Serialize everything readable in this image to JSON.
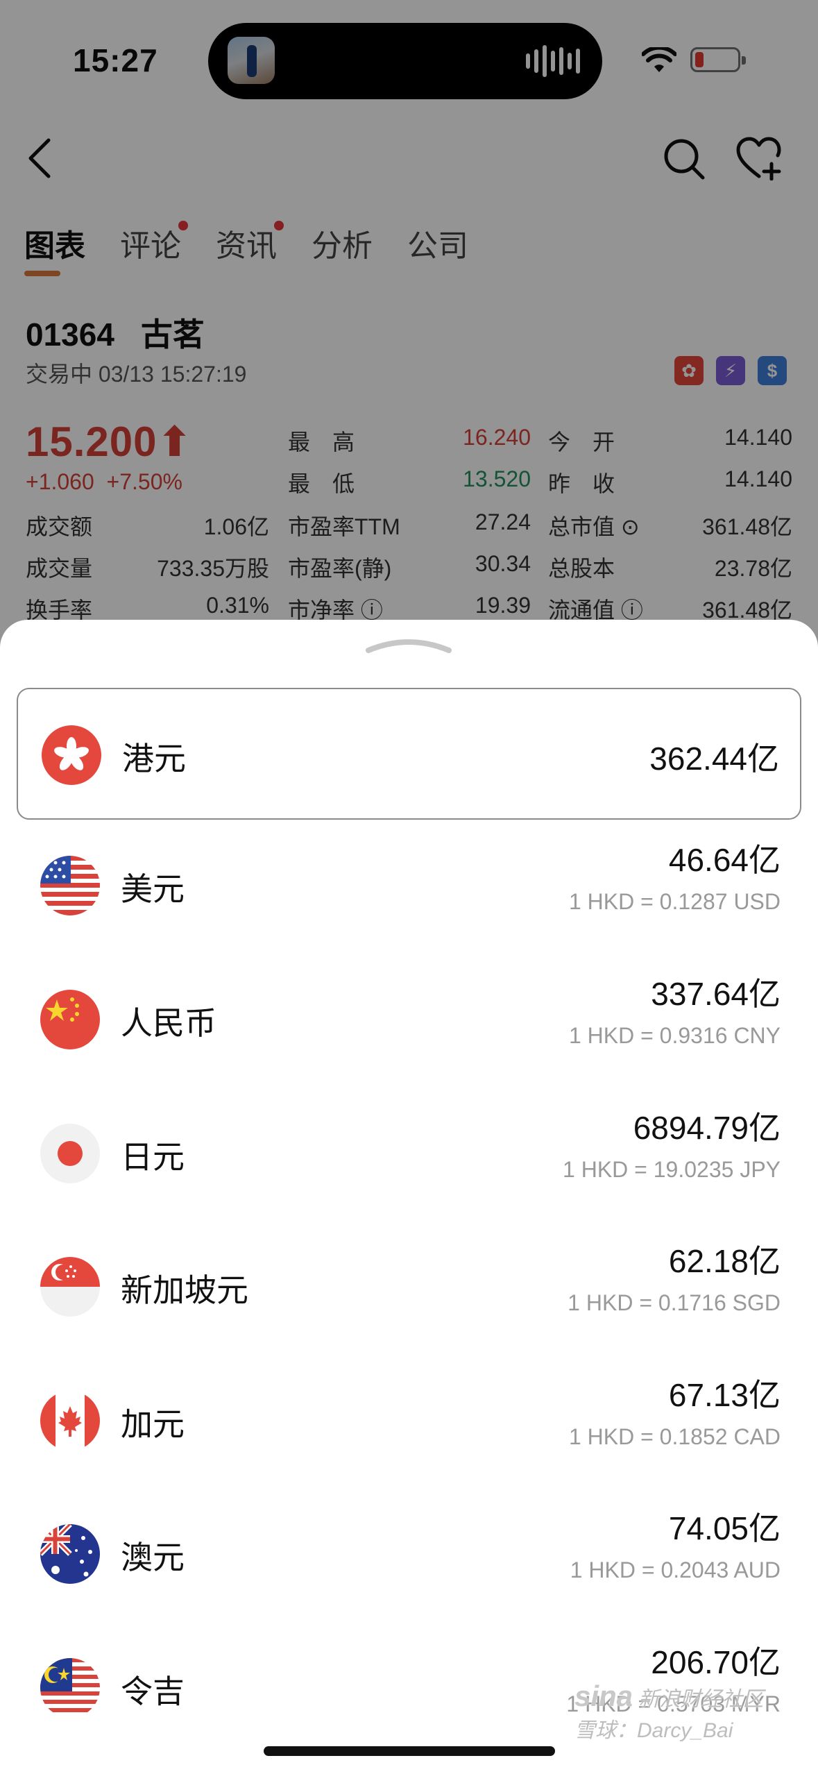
{
  "status_bar": {
    "time": "15:27"
  },
  "tabs": [
    {
      "label": "图表",
      "active": true,
      "dot": false
    },
    {
      "label": "评论",
      "active": false,
      "dot": true
    },
    {
      "label": "资讯",
      "active": false,
      "dot": true
    },
    {
      "label": "分析",
      "active": false,
      "dot": false
    },
    {
      "label": "公司",
      "active": false,
      "dot": false
    }
  ],
  "stock": {
    "code": "01364",
    "name": "古茗",
    "status": "交易中 03/13 15:27:19",
    "price": "15.200",
    "change": "+1.060",
    "change_pct": "+7.50%",
    "high_label": "最　高",
    "high_value": "16.240",
    "low_label": "最　低",
    "low_value": "13.520",
    "open_label": "今　开",
    "open_value": "14.140",
    "prev_label": "昨　收",
    "prev_value": "14.140",
    "turnover_label": "成交额",
    "turnover_value": "1.06亿",
    "volume_label": "成交量",
    "volume_value": "733.35万股",
    "rate_label": "换手率",
    "rate_value": "0.31%",
    "pe_ttm_label": "市盈率TTM",
    "pe_ttm_value": "27.24",
    "pe_static_label": "市盈率(静)",
    "pe_static_value": "30.34",
    "pb_label": "市净率",
    "pb_value": "19.39",
    "mcap_label": "总市值",
    "mcap_value": "361.48亿",
    "shares_label": "总股本",
    "shares_value": "23.78亿",
    "float_label": "流通值",
    "float_value": "361.48亿",
    "badges": [
      {
        "icon": "hk-flag-icon",
        "color": "#e4473c"
      },
      {
        "icon": "lightning-2-icon",
        "color": "#7b5cd6"
      },
      {
        "icon": "dollar-icon",
        "color": "#3f7fd9"
      }
    ]
  },
  "currencies": [
    {
      "name": "港元",
      "amount": "362.44亿",
      "rate": "",
      "flag": "hk-flag-icon",
      "selected": true
    },
    {
      "name": "美元",
      "amount": "46.64亿",
      "rate": "1 HKD = 0.1287 USD",
      "flag": "us-flag-icon",
      "selected": false
    },
    {
      "name": "人民币",
      "amount": "337.64亿",
      "rate": "1 HKD = 0.9316 CNY",
      "flag": "cn-flag-icon",
      "selected": false
    },
    {
      "name": "日元",
      "amount": "6894.79亿",
      "rate": "1 HKD = 19.0235 JPY",
      "flag": "jp-flag-icon",
      "selected": false
    },
    {
      "name": "新加坡元",
      "amount": "62.18亿",
      "rate": "1 HKD = 0.1716 SGD",
      "flag": "sg-flag-icon",
      "selected": false
    },
    {
      "name": "加元",
      "amount": "67.13亿",
      "rate": "1 HKD = 0.1852 CAD",
      "flag": "ca-flag-icon",
      "selected": false
    },
    {
      "name": "澳元",
      "amount": "74.05亿",
      "rate": "1 HKD = 0.2043 AUD",
      "flag": "au-flag-icon",
      "selected": false
    },
    {
      "name": "令吉",
      "amount": "206.70亿",
      "rate": "1 HKD = 0.5703 MYR",
      "flag": "my-flag-icon",
      "selected": false
    }
  ],
  "watermark": {
    "line1": "新浪财经社区",
    "line2": "雪球：Darcy_Bai"
  }
}
